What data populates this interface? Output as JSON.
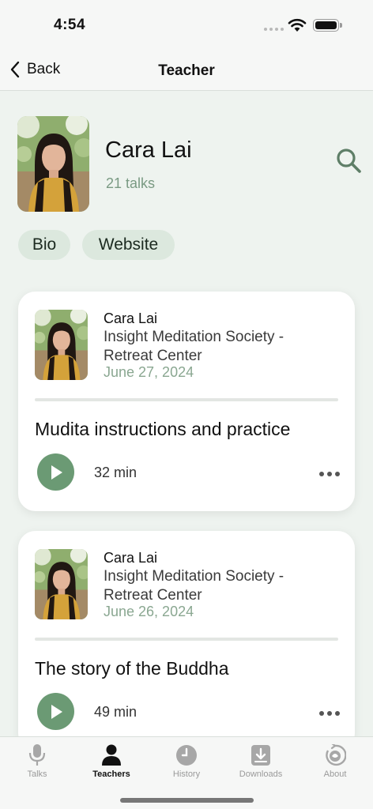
{
  "status": {
    "time": "4:54"
  },
  "nav": {
    "back_label": "Back",
    "title": "Teacher"
  },
  "teacher": {
    "name": "Cara Lai",
    "talk_count": "21 talks"
  },
  "actions": {
    "bio_label": "Bio",
    "website_label": "Website"
  },
  "talks": [
    {
      "teacher": "Cara Lai",
      "center": "Insight Meditation Society - Retreat Center",
      "date": "June 27, 2024",
      "title": "Mudita instructions and practice",
      "duration": "32 min"
    },
    {
      "teacher": "Cara Lai",
      "center": "Insight Meditation Society - Retreat Center",
      "date": "June 26, 2024",
      "title": "The story of the Buddha",
      "duration": "49 min"
    }
  ],
  "tabs": [
    {
      "label": "Talks",
      "icon": "microphone-icon"
    },
    {
      "label": "Teachers",
      "icon": "person-icon",
      "active": true
    },
    {
      "label": "History",
      "icon": "clock-icon"
    },
    {
      "label": "Downloads",
      "icon": "download-icon"
    },
    {
      "label": "About",
      "icon": "about-icon"
    }
  ],
  "colors": {
    "accent": "#6b9a74",
    "background": "#eef3ef",
    "muted_green": "#7a9a83",
    "pill_bg": "#dce8de"
  }
}
